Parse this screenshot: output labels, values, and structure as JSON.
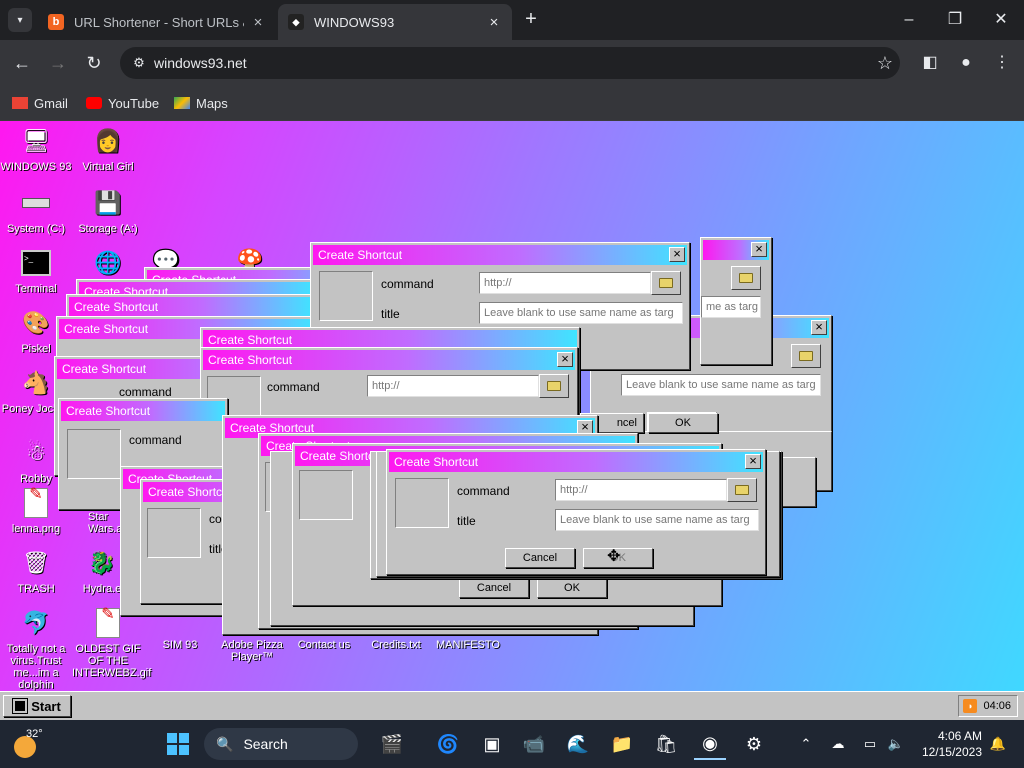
{
  "browser": {
    "tabs": [
      {
        "title": "URL Shortener - Short URLs & C",
        "favicon_color": "#f26522"
      },
      {
        "title": "WINDOWS93",
        "favicon_color": "#ffffff"
      }
    ],
    "address": "windows93.net",
    "bookmarks": [
      "Gmail",
      "YouTube",
      "Maps"
    ]
  },
  "desktop": {
    "icons": [
      {
        "label": "WINDOWS 93",
        "glyph": "🖥"
      },
      {
        "label": "Virtual Girl",
        "glyph": "👩"
      },
      {
        "label": "System (C:)",
        "glyph": "▭"
      },
      {
        "label": "Storage (A:)",
        "glyph": "💾"
      },
      {
        "label": "Terminal",
        "glyph": ">_"
      },
      {
        "label": "Piskel",
        "glyph": "🎨"
      },
      {
        "label": "Poney Jockey",
        "glyph": "🐴"
      },
      {
        "label": "Robby",
        "glyph": "☃"
      },
      {
        "label": "lenna.png",
        "glyph": "🖼"
      },
      {
        "label": "Star Wars.a",
        "glyph": ""
      },
      {
        "label": "TRASH",
        "glyph": "🗑"
      },
      {
        "label": "Hydra.e",
        "glyph": "🐉"
      },
      {
        "label": "Totally not a virus.Trust me...im a dolphin",
        "glyph": "🐬"
      },
      {
        "label": "OLDEST GIF OF THE INTERWEBZ.gif",
        "glyph": "🖼"
      },
      {
        "label": "SIM 93",
        "glyph": ""
      },
      {
        "label": "Adobe Pizza Player™",
        "glyph": ""
      },
      {
        "label": "Contact us",
        "glyph": ""
      },
      {
        "label": "Credits.txt",
        "glyph": ""
      },
      {
        "label": "MANIFESTO",
        "glyph": ""
      }
    ]
  },
  "dialog": {
    "title": "Create Shortcut",
    "command_label": "command",
    "title_label": "title",
    "command_placeholder": "http://",
    "title_placeholder": "Leave blank to use same name as targ",
    "cancel": "Cancel",
    "ok": "OK",
    "partial_cancel": "ncel"
  },
  "w93taskbar": {
    "start": "Start",
    "clock": "04:06"
  },
  "wintaskbar": {
    "temperature": "32°",
    "search": "Search",
    "time": "4:06 AM",
    "date": "12/15/2023"
  }
}
